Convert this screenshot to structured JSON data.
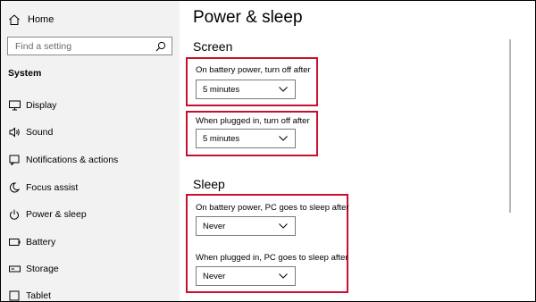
{
  "sidebar": {
    "home_label": "Home",
    "search_placeholder": "Find a setting",
    "section_title": "System",
    "items": [
      {
        "label": "Display",
        "icon": "display-icon"
      },
      {
        "label": "Sound",
        "icon": "speaker-icon"
      },
      {
        "label": "Notifications & actions",
        "icon": "notification-icon"
      },
      {
        "label": "Focus assist",
        "icon": "moon-icon"
      },
      {
        "label": "Power & sleep",
        "icon": "power-icon"
      },
      {
        "label": "Battery",
        "icon": "battery-icon"
      },
      {
        "label": "Storage",
        "icon": "storage-icon"
      },
      {
        "label": "Tablet",
        "icon": "tablet-icon"
      }
    ]
  },
  "main": {
    "title": "Power & sleep",
    "screen": {
      "title": "Screen",
      "battery_label": "On battery power, turn off after",
      "battery_value": "5 minutes",
      "plugged_label": "When plugged in, turn off after",
      "plugged_value": "5 minutes"
    },
    "sleep": {
      "title": "Sleep",
      "battery_label": "On battery power, PC goes to sleep after",
      "battery_value": "Never",
      "plugged_label": "When plugged in, PC goes to sleep after",
      "plugged_value": "Never"
    }
  },
  "colors": {
    "highlight": "#c8102e",
    "sidebar_bg": "#f2f2f2"
  }
}
